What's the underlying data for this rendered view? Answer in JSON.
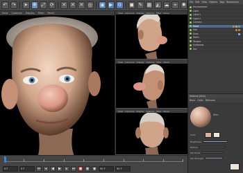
{
  "toolbar": {
    "buttons": [
      "undo-icon",
      "redo-icon",
      "select-icon",
      "move-icon",
      "scale-icon",
      "rotate-icon",
      "x-axis-icon",
      "y-axis-icon",
      "z-axis-icon",
      "world-icon",
      "render-region-icon",
      "render-view-icon",
      "render-settings-icon",
      "cube-icon",
      "pen-icon",
      "subdivide-icon",
      "deformer-icon",
      "environment-icon",
      "camera-icon",
      "light-icon"
    ],
    "active_index": 3
  },
  "viewports": {
    "main_menu": [
      "View",
      "Cameras",
      "Display",
      "Filter",
      "Panel"
    ],
    "small_menu": [
      "View",
      "Cameras",
      "Display",
      "Options",
      "Filter",
      "Panel"
    ]
  },
  "object_manager": {
    "menu": [
      "File",
      "Edit",
      "View",
      "Objects",
      "Tags",
      "Bookmarks"
    ],
    "rows": [
      {
        "label": "Environment",
        "selected": false
      },
      {
        "label": "Light",
        "selected": false
      },
      {
        "label": "Light.1",
        "selected": false
      },
      {
        "label": "Light.2",
        "selected": false
      },
      {
        "label": "Camera",
        "selected": false
      },
      {
        "label": "Head",
        "selected": true
      },
      {
        "label": "Hair",
        "selected": false
      },
      {
        "label": "Eyes",
        "selected": false
      },
      {
        "label": "Teeth",
        "selected": false
      },
      {
        "label": "Tongue",
        "selected": false
      },
      {
        "label": "Eyebrows",
        "selected": false
      },
      {
        "label": "Sky",
        "selected": false
      }
    ]
  },
  "material_panel": {
    "header": "Material [Skin]",
    "tabs": [
      "Basic",
      "Color",
      "Diffusion",
      "Luminance",
      "Transparency",
      "Reflectance"
    ],
    "preview_label": "Skin",
    "props": [
      "Color",
      "Brightness",
      "Texture",
      "Mix Mode",
      "Mix Strength"
    ]
  },
  "timeline": {
    "start": "0 F",
    "current": "0 F",
    "end": "90 F",
    "fps_field": "90 F",
    "ruler_labels": [
      "0",
      "10",
      "20",
      "30",
      "40",
      "50",
      "60",
      "70",
      "80",
      "90"
    ]
  },
  "colors": {
    "accent": "#4f7fb8",
    "selection": "#4f6a8f",
    "skin": "#d8b29a",
    "hair": "#cfc7c0"
  }
}
